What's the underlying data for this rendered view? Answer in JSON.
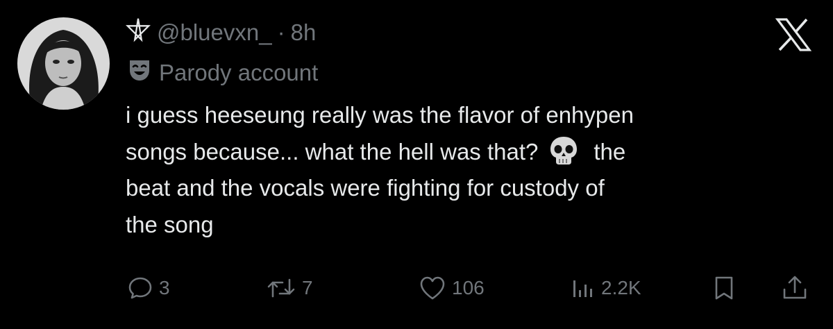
{
  "tweet": {
    "handle_icon": "pentagram-icon",
    "handle": "@bluevxn_",
    "separator": "·",
    "time": "8h",
    "badge_icon": "theater-mask-icon",
    "badge_label": "Parody account",
    "text_line_1": "i guess heeseung really was the flavor of enhypen",
    "text_line_2_a": "songs because... what the hell was that?",
    "text_line_2_emoji": "skull-icon",
    "text_line_2_b": "the",
    "text_line_3": "beat and the vocals were fighting for custody of",
    "text_line_4": "the song"
  },
  "actions": {
    "replies": "3",
    "reposts": "7",
    "likes": "106",
    "views": "2.2K"
  },
  "colors": {
    "background": "#000000",
    "text": "#e7e9ea",
    "muted": "#71767b"
  }
}
